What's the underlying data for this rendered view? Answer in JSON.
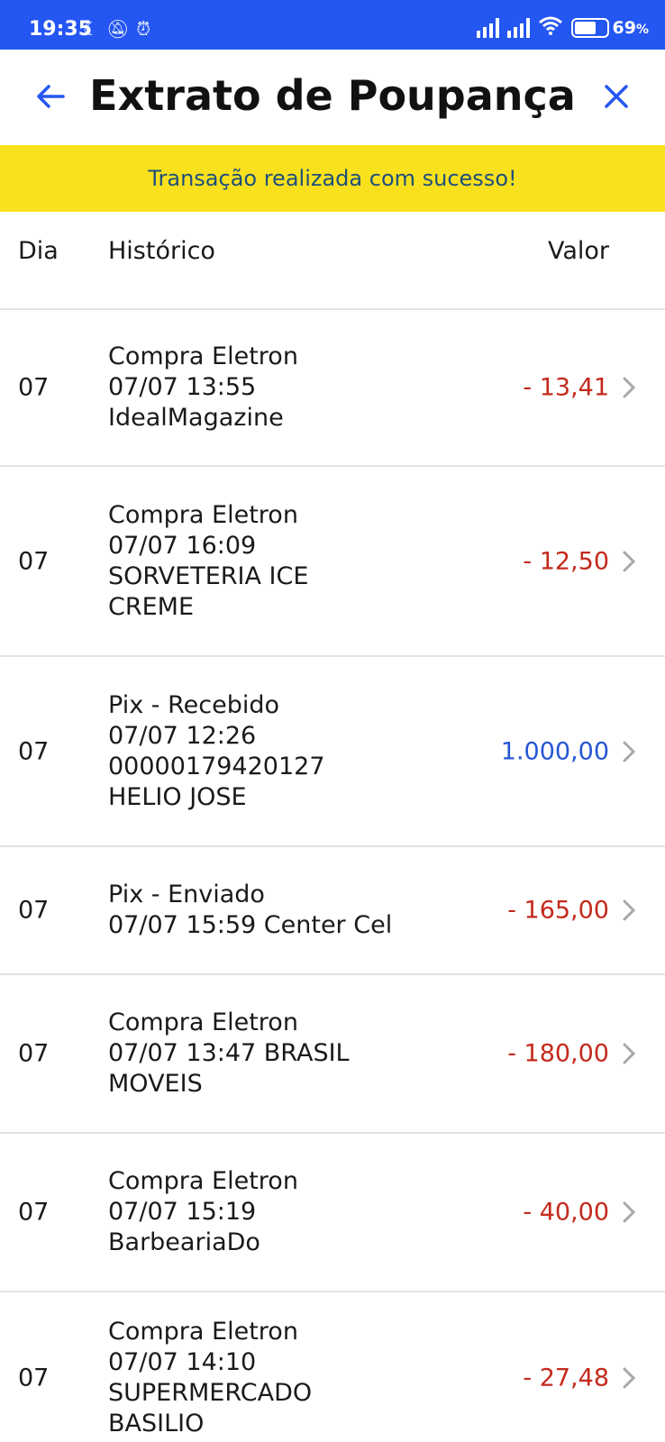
{
  "status_bar": {
    "time": "19:35",
    "icons": [
      "moon-icon",
      "notifications-off-icon",
      "alarm-icon"
    ],
    "battery_percent": "69",
    "battery_suffix": "%"
  },
  "header": {
    "title": "Extrato de Poupança",
    "back_icon": "arrow-left-icon",
    "close_icon": "close-icon"
  },
  "banner": {
    "message": "Transação realizada com sucesso!"
  },
  "table": {
    "col_day": "Dia",
    "col_history": "Histórico",
    "col_value": "Valor"
  },
  "transactions": [
    {
      "day": "07",
      "description": "Compra Eletron\n07/07 13:55\nIdealMagazine",
      "value": "- 13,41",
      "sign": "neg"
    },
    {
      "day": "07",
      "description": "Compra Eletron\n07/07 16:09\nSORVETERIA ICE\nCREME",
      "value": "- 12,50",
      "sign": "neg"
    },
    {
      "day": "07",
      "description": "Pix - Recebido\n07/07 12:26\n00000179420127\nHELIO JOSE",
      "value": "1.000,00",
      "sign": "pos"
    },
    {
      "day": "07",
      "description": "Pix - Enviado\n07/07 15:59 Center Cel",
      "value": "- 165,00",
      "sign": "neg"
    },
    {
      "day": "07",
      "description": "Compra Eletron\n07/07 13:47 BRASIL\nMOVEIS",
      "value": "- 180,00",
      "sign": "neg"
    },
    {
      "day": "07",
      "description": "Compra Eletron\n07/07 15:19\nBarbeariaDo",
      "value": "- 40,00",
      "sign": "neg"
    },
    {
      "day": "07",
      "description": "Compra Eletron\n07/07 14:10\nSUPERMERCADO\nBASILIO",
      "value": "- 27,48",
      "sign": "neg"
    }
  ],
  "colors": {
    "brand_blue": "#2456f2",
    "banner_yellow": "#f9e11e",
    "negative_red": "#c4291c",
    "positive_blue": "#2456d4"
  }
}
